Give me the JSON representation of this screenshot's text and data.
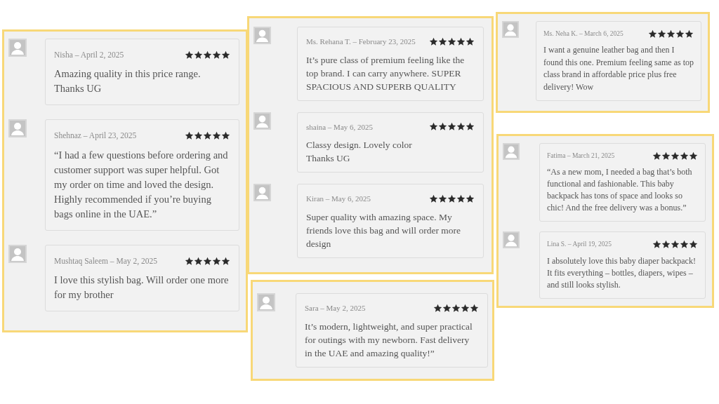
{
  "panels": [
    {
      "reviews": [
        {
          "meta": "Nisha – April 2, 2025",
          "stars": 5,
          "text": "Amazing quality in this price range. Thanks UG"
        },
        {
          "meta": "Shehnaz – April 23, 2025",
          "stars": 5,
          "text": "“I had a few questions before ordering and customer support was super helpful. Got my order on time and loved the design. Highly recommended if you’re buying bags online in the UAE.”"
        },
        {
          "meta": "Mushtaq Saleem – May 2, 2025",
          "stars": 5,
          "text": "I love this stylish bag. Will order one more for my brother"
        }
      ]
    },
    {
      "reviews": [
        {
          "meta": "Ms. Rehana T. – February 23, 2025",
          "stars": 5,
          "text": "It’s pure class of premium feeling like the top brand. I can carry anywhere. SUPER SPACIOUS AND SUPERB QUALITY"
        },
        {
          "meta": "shaina – May 6, 2025",
          "stars": 5,
          "text": "Classy design. Lovely color\nThanks UG"
        },
        {
          "meta": "Kiran – May 6, 2025",
          "stars": 5,
          "text": "Super quality with amazing space. My friends love this bag and will order more design"
        }
      ]
    },
    {
      "reviews": [
        {
          "meta": "Sara – May 2, 2025",
          "stars": 5,
          "text": "It’s modern, lightweight, and super practical for outings with my newborn. Fast delivery in the UAE and amazing quality!”"
        }
      ]
    },
    {
      "reviews": [
        {
          "meta": "Ms. Neha K. – March 6, 2025",
          "stars": 5,
          "text": "I want a genuine leather bag and then I found this one. Premium feeling same as top class brand in affordable price plus free delivery! Wow"
        }
      ]
    },
    {
      "reviews": [
        {
          "meta": "Fatima – March 21, 2025",
          "stars": 5,
          "text": "“As a new mom, I needed a bag that’s both functional and fashionable. This baby backpack has tons of space and looks so chic! And the free delivery was a bonus.”"
        },
        {
          "meta": "Lina S. – April 19, 2025",
          "stars": 5,
          "text": "I absolutely love this baby diaper backpack! It fits everything – bottles, diapers, wipes – and still looks stylish."
        }
      ]
    }
  ]
}
